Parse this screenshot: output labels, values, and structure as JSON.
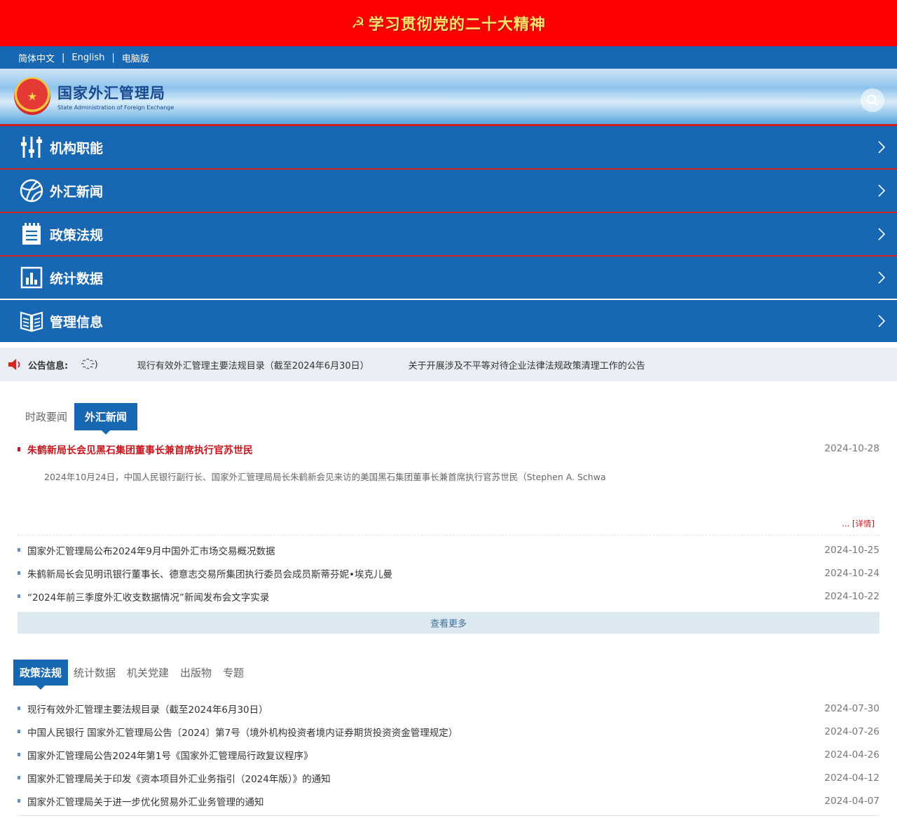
{
  "banner": {
    "text": "学习贯彻党的二十大精神"
  },
  "lang_bar": {
    "items": [
      "简体中文",
      "English",
      "电脑版"
    ]
  },
  "logo": {
    "cn": "国家外汇管理局",
    "en": "State Administration of Foreign Exchange"
  },
  "nav": {
    "items": [
      {
        "label": "机构职能"
      },
      {
        "label": "外汇新闻"
      },
      {
        "label": "政策法规"
      },
      {
        "label": "统计数据"
      },
      {
        "label": "管理信息"
      }
    ]
  },
  "notice": {
    "title": "公告信息:",
    "items": [
      "҈)",
      "现行有效外汇管理主要法规目录（截至2024年6月30日）",
      "关于开展涉及不平等对待企业法律法规政策清理工作的公告"
    ]
  },
  "news": {
    "tabs": [
      "时政要闻",
      "外汇新闻"
    ],
    "featured": {
      "title": "朱鹤新局长会见黑石集团董事长兼首席执行官苏世民",
      "date": "2024-10-28",
      "summary": "2024年10月24日，中国人民银行副行长、国家外汇管理局局长朱鹤新会见来访的美国黑石集团董事长兼首席执行官苏世民（Stephen A. Schwa",
      "more": "... [详情]"
    },
    "items": [
      {
        "title": "国家外汇管理局公布2024年9月中国外汇市场交易概况数据",
        "date": "2024-10-25"
      },
      {
        "title": "朱鹤新局长会见明讯银行董事长、德意志交易所集团执行委员会成员斯蒂芬妮•埃克儿曼",
        "date": "2024-10-24"
      },
      {
        "title": "“2024年前三季度外汇收支数据情况”新闻发布会文字实录",
        "date": "2024-10-22"
      }
    ],
    "more_label": "查看更多"
  },
  "policy": {
    "tabs": [
      "政策法规",
      "统计数据",
      "机关党建",
      "出版物",
      "专题"
    ],
    "items": [
      {
        "title": "现行有效外汇管理主要法规目录（截至2024年6月30日）",
        "date": "2024-07-30"
      },
      {
        "title": "中国人民银行 国家外汇管理局公告〔2024〕第7号（境外机构投资者境内证券期货投资资金管理规定）",
        "date": "2024-07-26"
      },
      {
        "title": "国家外汇管理局公告2024年第1号《国家外汇管理局行政复议程序》",
        "date": "2024-04-26"
      },
      {
        "title": "国家外汇管理局关于印发《资本项目外汇业务指引（2024年版）》的通知",
        "date": "2024-04-12"
      },
      {
        "title": "国家外汇管理局关于进一步优化贸易外汇业务管理的通知",
        "date": "2024-04-07"
      }
    ]
  },
  "colors": {
    "primary": "#1767b3",
    "banner": "#ff0000",
    "accent_red": "#c8161d"
  }
}
